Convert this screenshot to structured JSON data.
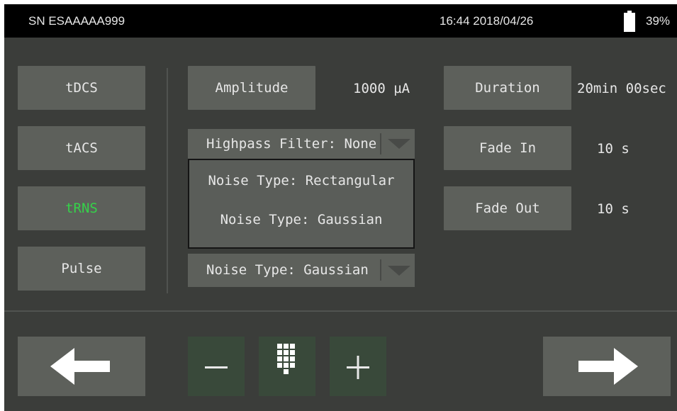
{
  "status": {
    "serial": "SN ESAAAAA999",
    "datetime": "16:44 2018/04/26",
    "battery": "39%"
  },
  "modes": [
    {
      "label": "tDCS"
    },
    {
      "label": "tACS"
    },
    {
      "label": "tRNS",
      "active": true
    },
    {
      "label": "Pulse"
    }
  ],
  "params": {
    "amplitude_label": "Amplitude",
    "amplitude_value": "1000 µA",
    "highpass_label": "Highpass Filter: None",
    "noise_label": "Noise Type: Gaussian",
    "duration_label": "Duration",
    "duration_value": "20min 00sec",
    "fadein_label": "Fade In",
    "fadein_value": "10 s",
    "fadeout_label": "Fade Out",
    "fadeout_value": "10 s"
  },
  "dropdown": {
    "options": [
      "Noise Type: Rectangular",
      "Noise Type: Gaussian"
    ]
  },
  "icons": {
    "back": "left-arrow-icon",
    "next": "right-arrow-icon",
    "minus": "minus-icon",
    "keypad": "keypad-icon",
    "plus": "plus-icon",
    "battery": "battery-icon"
  },
  "colors": {
    "background": "#3b3d3a",
    "button": "#5d605b",
    "active_mode_text": "#35d24a",
    "stepper": "#39493a",
    "statusbar": "#000000"
  }
}
